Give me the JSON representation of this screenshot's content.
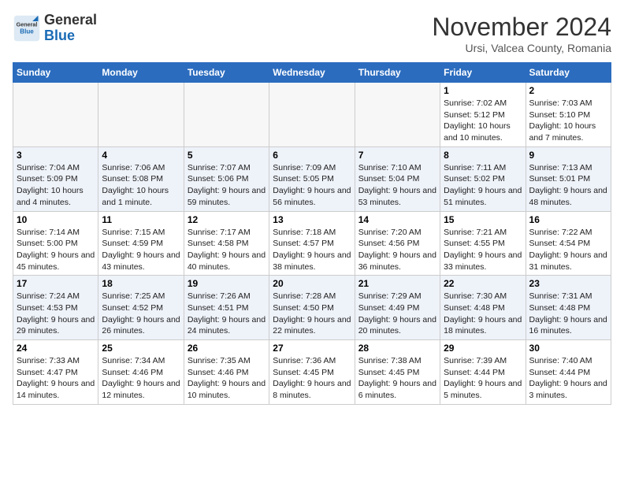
{
  "header": {
    "logo_general": "General",
    "logo_blue": "Blue",
    "month_title": "November 2024",
    "subtitle": "Ursi, Valcea County, Romania"
  },
  "weekdays": [
    "Sunday",
    "Monday",
    "Tuesday",
    "Wednesday",
    "Thursday",
    "Friday",
    "Saturday"
  ],
  "weeks": [
    [
      {
        "day": "",
        "info": ""
      },
      {
        "day": "",
        "info": ""
      },
      {
        "day": "",
        "info": ""
      },
      {
        "day": "",
        "info": ""
      },
      {
        "day": "",
        "info": ""
      },
      {
        "day": "1",
        "info": "Sunrise: 7:02 AM\nSunset: 5:12 PM\nDaylight: 10 hours and 10 minutes."
      },
      {
        "day": "2",
        "info": "Sunrise: 7:03 AM\nSunset: 5:10 PM\nDaylight: 10 hours and 7 minutes."
      }
    ],
    [
      {
        "day": "3",
        "info": "Sunrise: 7:04 AM\nSunset: 5:09 PM\nDaylight: 10 hours and 4 minutes."
      },
      {
        "day": "4",
        "info": "Sunrise: 7:06 AM\nSunset: 5:08 PM\nDaylight: 10 hours and 1 minute."
      },
      {
        "day": "5",
        "info": "Sunrise: 7:07 AM\nSunset: 5:06 PM\nDaylight: 9 hours and 59 minutes."
      },
      {
        "day": "6",
        "info": "Sunrise: 7:09 AM\nSunset: 5:05 PM\nDaylight: 9 hours and 56 minutes."
      },
      {
        "day": "7",
        "info": "Sunrise: 7:10 AM\nSunset: 5:04 PM\nDaylight: 9 hours and 53 minutes."
      },
      {
        "day": "8",
        "info": "Sunrise: 7:11 AM\nSunset: 5:02 PM\nDaylight: 9 hours and 51 minutes."
      },
      {
        "day": "9",
        "info": "Sunrise: 7:13 AM\nSunset: 5:01 PM\nDaylight: 9 hours and 48 minutes."
      }
    ],
    [
      {
        "day": "10",
        "info": "Sunrise: 7:14 AM\nSunset: 5:00 PM\nDaylight: 9 hours and 45 minutes."
      },
      {
        "day": "11",
        "info": "Sunrise: 7:15 AM\nSunset: 4:59 PM\nDaylight: 9 hours and 43 minutes."
      },
      {
        "day": "12",
        "info": "Sunrise: 7:17 AM\nSunset: 4:58 PM\nDaylight: 9 hours and 40 minutes."
      },
      {
        "day": "13",
        "info": "Sunrise: 7:18 AM\nSunset: 4:57 PM\nDaylight: 9 hours and 38 minutes."
      },
      {
        "day": "14",
        "info": "Sunrise: 7:20 AM\nSunset: 4:56 PM\nDaylight: 9 hours and 36 minutes."
      },
      {
        "day": "15",
        "info": "Sunrise: 7:21 AM\nSunset: 4:55 PM\nDaylight: 9 hours and 33 minutes."
      },
      {
        "day": "16",
        "info": "Sunrise: 7:22 AM\nSunset: 4:54 PM\nDaylight: 9 hours and 31 minutes."
      }
    ],
    [
      {
        "day": "17",
        "info": "Sunrise: 7:24 AM\nSunset: 4:53 PM\nDaylight: 9 hours and 29 minutes."
      },
      {
        "day": "18",
        "info": "Sunrise: 7:25 AM\nSunset: 4:52 PM\nDaylight: 9 hours and 26 minutes."
      },
      {
        "day": "19",
        "info": "Sunrise: 7:26 AM\nSunset: 4:51 PM\nDaylight: 9 hours and 24 minutes."
      },
      {
        "day": "20",
        "info": "Sunrise: 7:28 AM\nSunset: 4:50 PM\nDaylight: 9 hours and 22 minutes."
      },
      {
        "day": "21",
        "info": "Sunrise: 7:29 AM\nSunset: 4:49 PM\nDaylight: 9 hours and 20 minutes."
      },
      {
        "day": "22",
        "info": "Sunrise: 7:30 AM\nSunset: 4:48 PM\nDaylight: 9 hours and 18 minutes."
      },
      {
        "day": "23",
        "info": "Sunrise: 7:31 AM\nSunset: 4:48 PM\nDaylight: 9 hours and 16 minutes."
      }
    ],
    [
      {
        "day": "24",
        "info": "Sunrise: 7:33 AM\nSunset: 4:47 PM\nDaylight: 9 hours and 14 minutes."
      },
      {
        "day": "25",
        "info": "Sunrise: 7:34 AM\nSunset: 4:46 PM\nDaylight: 9 hours and 12 minutes."
      },
      {
        "day": "26",
        "info": "Sunrise: 7:35 AM\nSunset: 4:46 PM\nDaylight: 9 hours and 10 minutes."
      },
      {
        "day": "27",
        "info": "Sunrise: 7:36 AM\nSunset: 4:45 PM\nDaylight: 9 hours and 8 minutes."
      },
      {
        "day": "28",
        "info": "Sunrise: 7:38 AM\nSunset: 4:45 PM\nDaylight: 9 hours and 6 minutes."
      },
      {
        "day": "29",
        "info": "Sunrise: 7:39 AM\nSunset: 4:44 PM\nDaylight: 9 hours and 5 minutes."
      },
      {
        "day": "30",
        "info": "Sunrise: 7:40 AM\nSunset: 4:44 PM\nDaylight: 9 hours and 3 minutes."
      }
    ]
  ]
}
